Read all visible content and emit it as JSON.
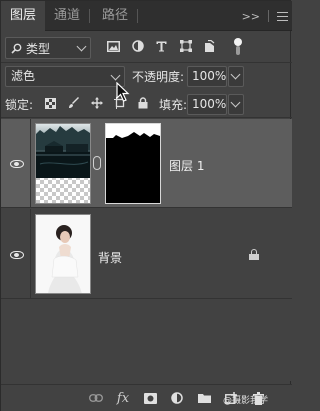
{
  "tabs": [
    {
      "label": "图层",
      "active": true
    },
    {
      "label": "通道",
      "active": false
    },
    {
      "label": "路径",
      "active": false
    }
  ],
  "tabbar": {
    "collapse_label": ">>"
  },
  "filter": {
    "kind_label": "类型"
  },
  "blend": {
    "mode": "滤色",
    "opacity_label": "不透明度:",
    "opacity_value": "100%"
  },
  "lock": {
    "label": "锁定:",
    "fill_label": "填充:",
    "fill_value": "100%"
  },
  "layers": [
    {
      "name": "图层 1",
      "selected": true,
      "visible": true,
      "has_mask": true
    },
    {
      "name": "背景",
      "selected": false,
      "visible": true,
      "locked": true
    }
  ],
  "footer": {
    "watermark": "@摄影我学"
  },
  "colors": {
    "panel": "#424242",
    "tabbar": "#2f2f2f",
    "selected_row": "#5d5d5d"
  },
  "icons": {
    "filter": [
      "image-filter-icon",
      "adjustment-filter-icon",
      "type-filter-icon",
      "shape-filter-icon",
      "smart-object-filter-icon"
    ],
    "lock": [
      "lock-transparent-icon",
      "lock-image-icon",
      "lock-position-icon",
      "lock-artboard-icon",
      "lock-all-icon"
    ],
    "bottom": [
      "link-layers-icon",
      "fx-icon",
      "add-mask-icon",
      "new-adjustment-icon",
      "new-group-icon",
      "new-layer-icon",
      "delete-layer-icon"
    ]
  }
}
